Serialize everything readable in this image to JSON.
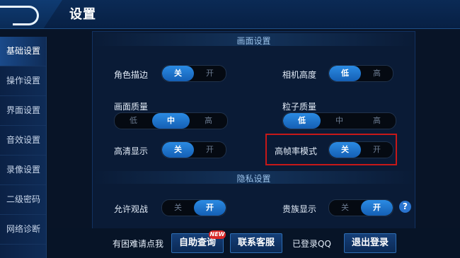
{
  "header": {
    "title": "设置"
  },
  "sidebar": {
    "items": [
      {
        "label": "基础设置"
      },
      {
        "label": "操作设置"
      },
      {
        "label": "界面设置"
      },
      {
        "label": "音效设置"
      },
      {
        "label": "录像设置"
      },
      {
        "label": "二级密码"
      },
      {
        "label": "网络诊断"
      }
    ],
    "active_index": 0
  },
  "sections": {
    "display": "画面设置",
    "privacy": "隐私设置"
  },
  "settings": {
    "outline": {
      "label": "角色描边",
      "options": [
        "关",
        "开"
      ],
      "selected": "关"
    },
    "camera_height": {
      "label": "相机高度",
      "options": [
        "低",
        "高"
      ],
      "selected": "低"
    },
    "quality": {
      "label": "画面质量",
      "options": [
        "低",
        "中",
        "高"
      ],
      "selected": "中"
    },
    "particle": {
      "label": "粒子质量",
      "options": [
        "低",
        "中",
        "高"
      ],
      "selected": "低"
    },
    "hd": {
      "label": "高清显示",
      "options": [
        "关",
        "开"
      ],
      "selected": "关"
    },
    "hfr": {
      "label": "高帧率模式",
      "options": [
        "关",
        "开"
      ],
      "selected": "关"
    },
    "spectate": {
      "label": "允许观战",
      "options": [
        "关",
        "开"
      ],
      "selected": "开"
    },
    "noble": {
      "label": "贵族显示",
      "options": [
        "关",
        "开"
      ],
      "selected": "开"
    }
  },
  "help_icon": "question-icon",
  "bottom": {
    "help_text": "有困难请点我",
    "self_query": "自助查询",
    "new_badge": "NEW",
    "support": "联系客服",
    "login_status": "已登录QQ",
    "logout": "退出登录"
  },
  "colors": {
    "accent": "#1f7fdd",
    "highlight_border": "#c61818"
  }
}
